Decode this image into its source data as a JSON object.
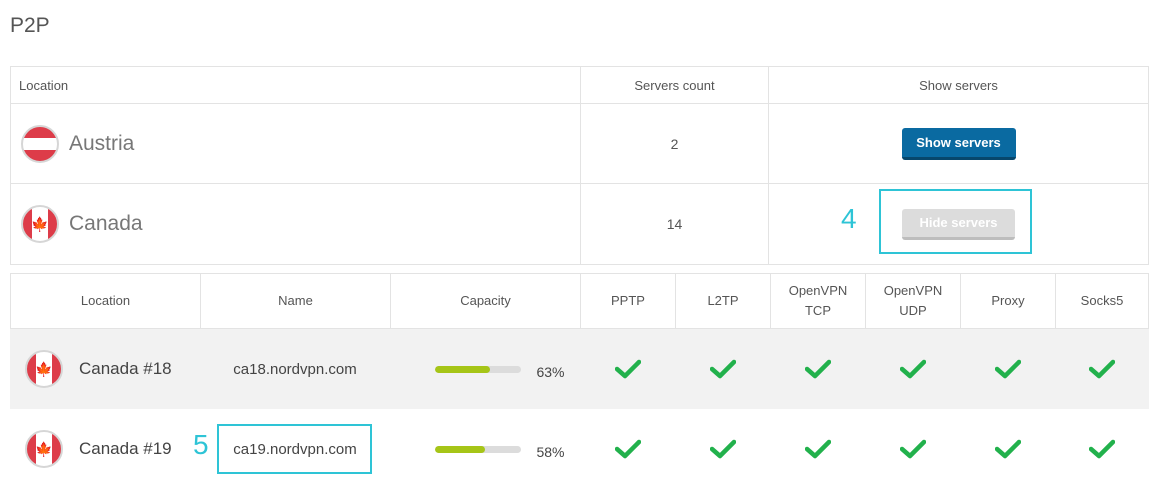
{
  "page": {
    "title": "P2P"
  },
  "countries_table": {
    "headers": {
      "location": "Location",
      "servers_count": "Servers count",
      "show_servers": "Show servers"
    },
    "rows": [
      {
        "country": "Austria",
        "flag": "austria-flag-icon",
        "count": "2",
        "button": "Show servers",
        "button_state": "active"
      },
      {
        "country": "Canada",
        "flag": "canada-flag-icon",
        "count": "14",
        "button": "Hide servers",
        "button_state": "disabled"
      }
    ]
  },
  "servers_table": {
    "headers": {
      "location": "Location",
      "name": "Name",
      "capacity": "Capacity",
      "pptp": "PPTP",
      "l2tp": "L2TP",
      "openvpn_tcp_1": "OpenVPN",
      "openvpn_tcp_2": "TCP",
      "openvpn_udp_1": "OpenVPN",
      "openvpn_udp_2": "UDP",
      "proxy": "Proxy",
      "socks5": "Socks5"
    },
    "rows": [
      {
        "location": "Canada #18",
        "name": "ca18.nordvpn.com",
        "capacity": 0.63,
        "capacity_label": "63%",
        "pptp": true,
        "l2tp": true,
        "openvpn_tcp": true,
        "openvpn_udp": true,
        "proxy": true,
        "socks5": true
      },
      {
        "location": "Canada #19",
        "name": "ca19.nordvpn.com",
        "capacity": 0.58,
        "capacity_label": "58%",
        "pptp": true,
        "l2tp": true,
        "openvpn_tcp": true,
        "openvpn_udp": true,
        "proxy": true,
        "socks5": true
      }
    ]
  },
  "annotations": {
    "callout_4": "4",
    "callout_5": "5"
  },
  "colors": {
    "primary_button": "#0a6aa1",
    "callout": "#2ec4d6",
    "check": "#22b14c",
    "capacity_fill": "#a6c517",
    "flag_red": "#dd3c49"
  }
}
